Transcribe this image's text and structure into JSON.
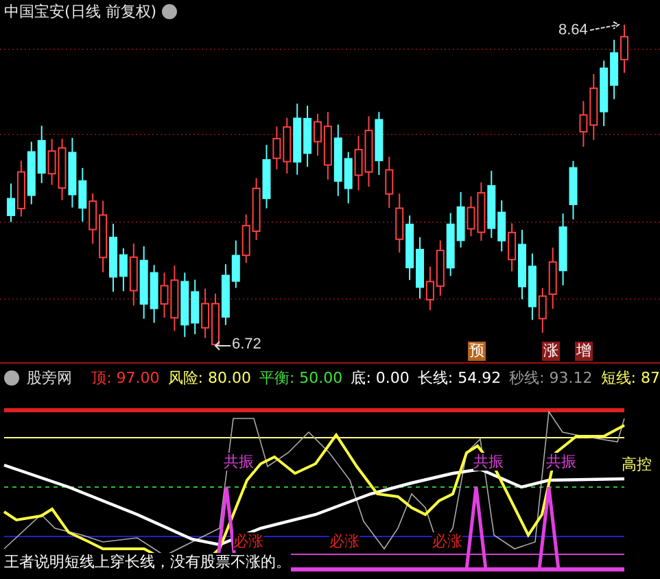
{
  "main_chart": {
    "title": "中国宝安(日线 前复权)",
    "high_label": "8.64",
    "low_label": "6.72",
    "signals": [
      {
        "text": "预",
        "color": "#b5651d"
      },
      {
        "text": "涨",
        "color": "#8b1a1a"
      },
      {
        "text": "增",
        "color": "#8b1a1a"
      }
    ]
  },
  "indicator": {
    "name": "股旁网",
    "values": [
      {
        "label": "顶:",
        "value": "97.00",
        "color": "#ff3030"
      },
      {
        "label": "风险:",
        "value": "80.00",
        "color": "#ffff60"
      },
      {
        "label": "平衡:",
        "value": "50.00",
        "color": "#40e040"
      },
      {
        "label": "底:",
        "value": "0.00",
        "color": "#ffffff"
      },
      {
        "label": "长线:",
        "value": "54.92",
        "color": "#ffffff"
      },
      {
        "label": "秒线:",
        "value": "93.12",
        "color": "#9a9a9a"
      },
      {
        "label": "短线:",
        "value": "87",
        "color": "#ffff60"
      }
    ],
    "labels": [
      {
        "text": "共振",
        "kind": "resonance"
      },
      {
        "text": "共振",
        "kind": "resonance"
      },
      {
        "text": "共振",
        "kind": "resonance"
      },
      {
        "text": "必涨",
        "kind": "rise"
      },
      {
        "text": "必涨",
        "kind": "rise"
      },
      {
        "text": "必涨",
        "kind": "rise"
      },
      {
        "text": "高控",
        "kind": "control"
      }
    ],
    "note": "王者说明短线上穿长线，没有股票不涨的。"
  }
}
